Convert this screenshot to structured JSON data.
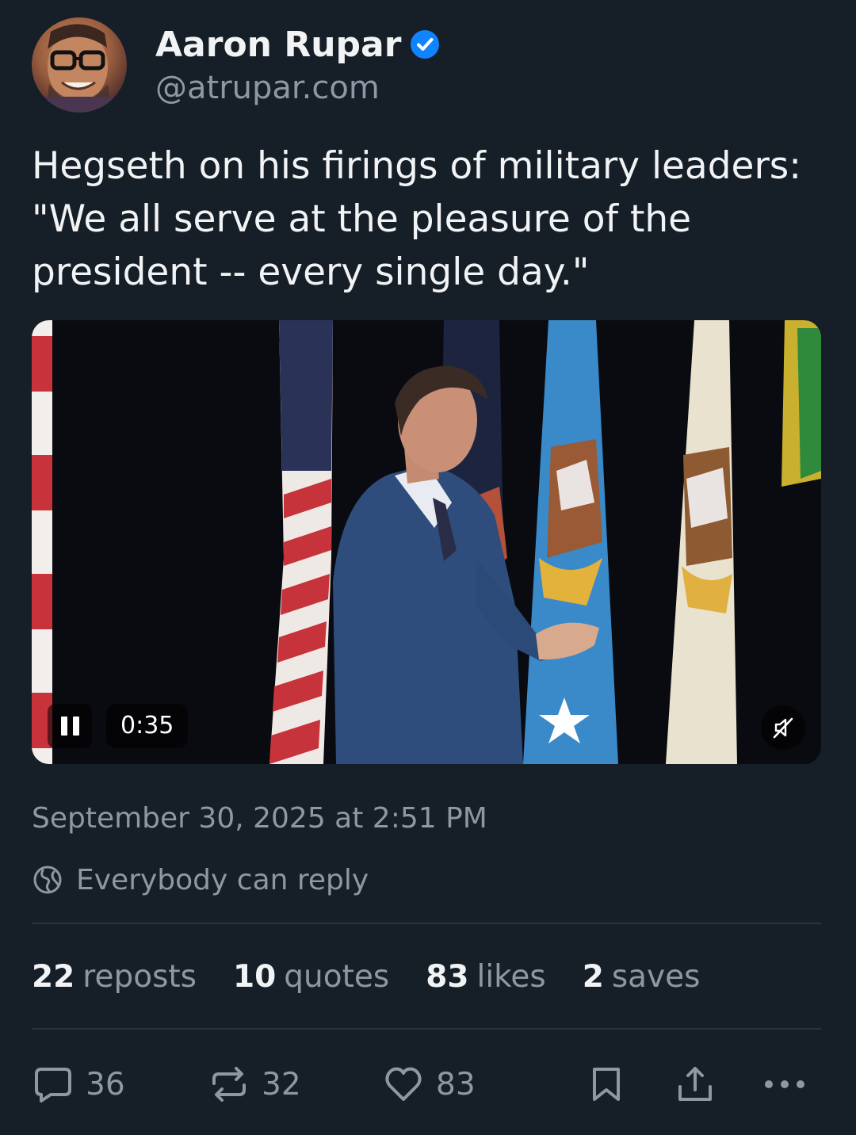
{
  "author": {
    "display_name": "Aaron Rupar",
    "handle": "@atrupar.com",
    "verified": true
  },
  "post": {
    "text": "Hegseth on his firings of military leaders: \"We all serve at the pleasure of the president -- every single day.\""
  },
  "video": {
    "duration": "0:35",
    "state": "playing",
    "muted": true
  },
  "timestamp": "September 30, 2025 at 2:51 PM",
  "reply_setting": "Everybody can reply",
  "stats": {
    "reposts": {
      "count": "22",
      "label": "reposts"
    },
    "quotes": {
      "count": "10",
      "label": "quotes"
    },
    "likes": {
      "count": "83",
      "label": "likes"
    },
    "saves": {
      "count": "2",
      "label": "saves"
    }
  },
  "actions": {
    "reply_count": "36",
    "repost_count": "32",
    "like_count": "83"
  },
  "colors": {
    "background": "#161e27",
    "text_primary": "#f1f3f5",
    "text_secondary": "#8d98a5",
    "verified_badge": "#1083fe",
    "divider": "#2b343e"
  },
  "icons": [
    "verified-badge-icon",
    "pause-icon",
    "mute-icon",
    "globe-icon",
    "reply-icon",
    "repost-icon",
    "heart-icon",
    "bookmark-icon",
    "share-icon",
    "more-icon"
  ]
}
